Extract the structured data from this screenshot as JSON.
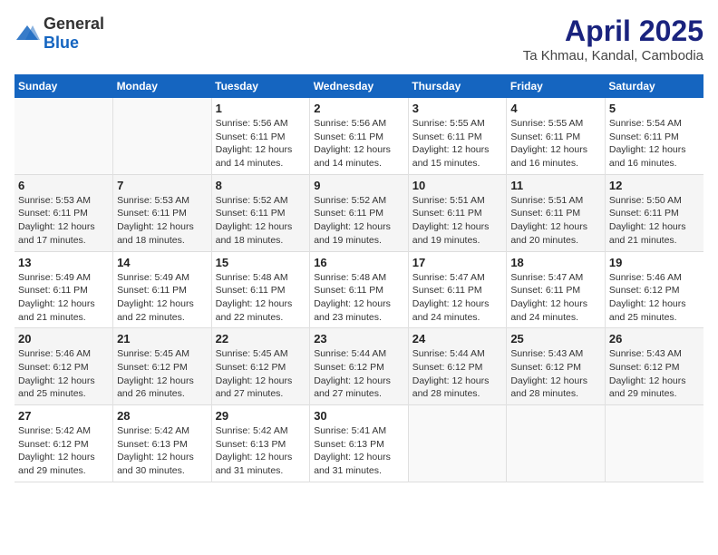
{
  "header": {
    "logo_general": "General",
    "logo_blue": "Blue",
    "title": "April 2025",
    "subtitle": "Ta Khmau, Kandal, Cambodia"
  },
  "weekdays": [
    "Sunday",
    "Monday",
    "Tuesday",
    "Wednesday",
    "Thursday",
    "Friday",
    "Saturday"
  ],
  "weeks": [
    [
      {
        "day": "",
        "sunrise": "",
        "sunset": "",
        "daylight": ""
      },
      {
        "day": "",
        "sunrise": "",
        "sunset": "",
        "daylight": ""
      },
      {
        "day": "1",
        "sunrise": "Sunrise: 5:56 AM",
        "sunset": "Sunset: 6:11 PM",
        "daylight": "Daylight: 12 hours and 14 minutes."
      },
      {
        "day": "2",
        "sunrise": "Sunrise: 5:56 AM",
        "sunset": "Sunset: 6:11 PM",
        "daylight": "Daylight: 12 hours and 14 minutes."
      },
      {
        "day": "3",
        "sunrise": "Sunrise: 5:55 AM",
        "sunset": "Sunset: 6:11 PM",
        "daylight": "Daylight: 12 hours and 15 minutes."
      },
      {
        "day": "4",
        "sunrise": "Sunrise: 5:55 AM",
        "sunset": "Sunset: 6:11 PM",
        "daylight": "Daylight: 12 hours and 16 minutes."
      },
      {
        "day": "5",
        "sunrise": "Sunrise: 5:54 AM",
        "sunset": "Sunset: 6:11 PM",
        "daylight": "Daylight: 12 hours and 16 minutes."
      }
    ],
    [
      {
        "day": "6",
        "sunrise": "Sunrise: 5:53 AM",
        "sunset": "Sunset: 6:11 PM",
        "daylight": "Daylight: 12 hours and 17 minutes."
      },
      {
        "day": "7",
        "sunrise": "Sunrise: 5:53 AM",
        "sunset": "Sunset: 6:11 PM",
        "daylight": "Daylight: 12 hours and 18 minutes."
      },
      {
        "day": "8",
        "sunrise": "Sunrise: 5:52 AM",
        "sunset": "Sunset: 6:11 PM",
        "daylight": "Daylight: 12 hours and 18 minutes."
      },
      {
        "day": "9",
        "sunrise": "Sunrise: 5:52 AM",
        "sunset": "Sunset: 6:11 PM",
        "daylight": "Daylight: 12 hours and 19 minutes."
      },
      {
        "day": "10",
        "sunrise": "Sunrise: 5:51 AM",
        "sunset": "Sunset: 6:11 PM",
        "daylight": "Daylight: 12 hours and 19 minutes."
      },
      {
        "day": "11",
        "sunrise": "Sunrise: 5:51 AM",
        "sunset": "Sunset: 6:11 PM",
        "daylight": "Daylight: 12 hours and 20 minutes."
      },
      {
        "day": "12",
        "sunrise": "Sunrise: 5:50 AM",
        "sunset": "Sunset: 6:11 PM",
        "daylight": "Daylight: 12 hours and 21 minutes."
      }
    ],
    [
      {
        "day": "13",
        "sunrise": "Sunrise: 5:49 AM",
        "sunset": "Sunset: 6:11 PM",
        "daylight": "Daylight: 12 hours and 21 minutes."
      },
      {
        "day": "14",
        "sunrise": "Sunrise: 5:49 AM",
        "sunset": "Sunset: 6:11 PM",
        "daylight": "Daylight: 12 hours and 22 minutes."
      },
      {
        "day": "15",
        "sunrise": "Sunrise: 5:48 AM",
        "sunset": "Sunset: 6:11 PM",
        "daylight": "Daylight: 12 hours and 22 minutes."
      },
      {
        "day": "16",
        "sunrise": "Sunrise: 5:48 AM",
        "sunset": "Sunset: 6:11 PM",
        "daylight": "Daylight: 12 hours and 23 minutes."
      },
      {
        "day": "17",
        "sunrise": "Sunrise: 5:47 AM",
        "sunset": "Sunset: 6:11 PM",
        "daylight": "Daylight: 12 hours and 24 minutes."
      },
      {
        "day": "18",
        "sunrise": "Sunrise: 5:47 AM",
        "sunset": "Sunset: 6:11 PM",
        "daylight": "Daylight: 12 hours and 24 minutes."
      },
      {
        "day": "19",
        "sunrise": "Sunrise: 5:46 AM",
        "sunset": "Sunset: 6:12 PM",
        "daylight": "Daylight: 12 hours and 25 minutes."
      }
    ],
    [
      {
        "day": "20",
        "sunrise": "Sunrise: 5:46 AM",
        "sunset": "Sunset: 6:12 PM",
        "daylight": "Daylight: 12 hours and 25 minutes."
      },
      {
        "day": "21",
        "sunrise": "Sunrise: 5:45 AM",
        "sunset": "Sunset: 6:12 PM",
        "daylight": "Daylight: 12 hours and 26 minutes."
      },
      {
        "day": "22",
        "sunrise": "Sunrise: 5:45 AM",
        "sunset": "Sunset: 6:12 PM",
        "daylight": "Daylight: 12 hours and 27 minutes."
      },
      {
        "day": "23",
        "sunrise": "Sunrise: 5:44 AM",
        "sunset": "Sunset: 6:12 PM",
        "daylight": "Daylight: 12 hours and 27 minutes."
      },
      {
        "day": "24",
        "sunrise": "Sunrise: 5:44 AM",
        "sunset": "Sunset: 6:12 PM",
        "daylight": "Daylight: 12 hours and 28 minutes."
      },
      {
        "day": "25",
        "sunrise": "Sunrise: 5:43 AM",
        "sunset": "Sunset: 6:12 PM",
        "daylight": "Daylight: 12 hours and 28 minutes."
      },
      {
        "day": "26",
        "sunrise": "Sunrise: 5:43 AM",
        "sunset": "Sunset: 6:12 PM",
        "daylight": "Daylight: 12 hours and 29 minutes."
      }
    ],
    [
      {
        "day": "27",
        "sunrise": "Sunrise: 5:42 AM",
        "sunset": "Sunset: 6:12 PM",
        "daylight": "Daylight: 12 hours and 29 minutes."
      },
      {
        "day": "28",
        "sunrise": "Sunrise: 5:42 AM",
        "sunset": "Sunset: 6:13 PM",
        "daylight": "Daylight: 12 hours and 30 minutes."
      },
      {
        "day": "29",
        "sunrise": "Sunrise: 5:42 AM",
        "sunset": "Sunset: 6:13 PM",
        "daylight": "Daylight: 12 hours and 31 minutes."
      },
      {
        "day": "30",
        "sunrise": "Sunrise: 5:41 AM",
        "sunset": "Sunset: 6:13 PM",
        "daylight": "Daylight: 12 hours and 31 minutes."
      },
      {
        "day": "",
        "sunrise": "",
        "sunset": "",
        "daylight": ""
      },
      {
        "day": "",
        "sunrise": "",
        "sunset": "",
        "daylight": ""
      },
      {
        "day": "",
        "sunrise": "",
        "sunset": "",
        "daylight": ""
      }
    ]
  ]
}
